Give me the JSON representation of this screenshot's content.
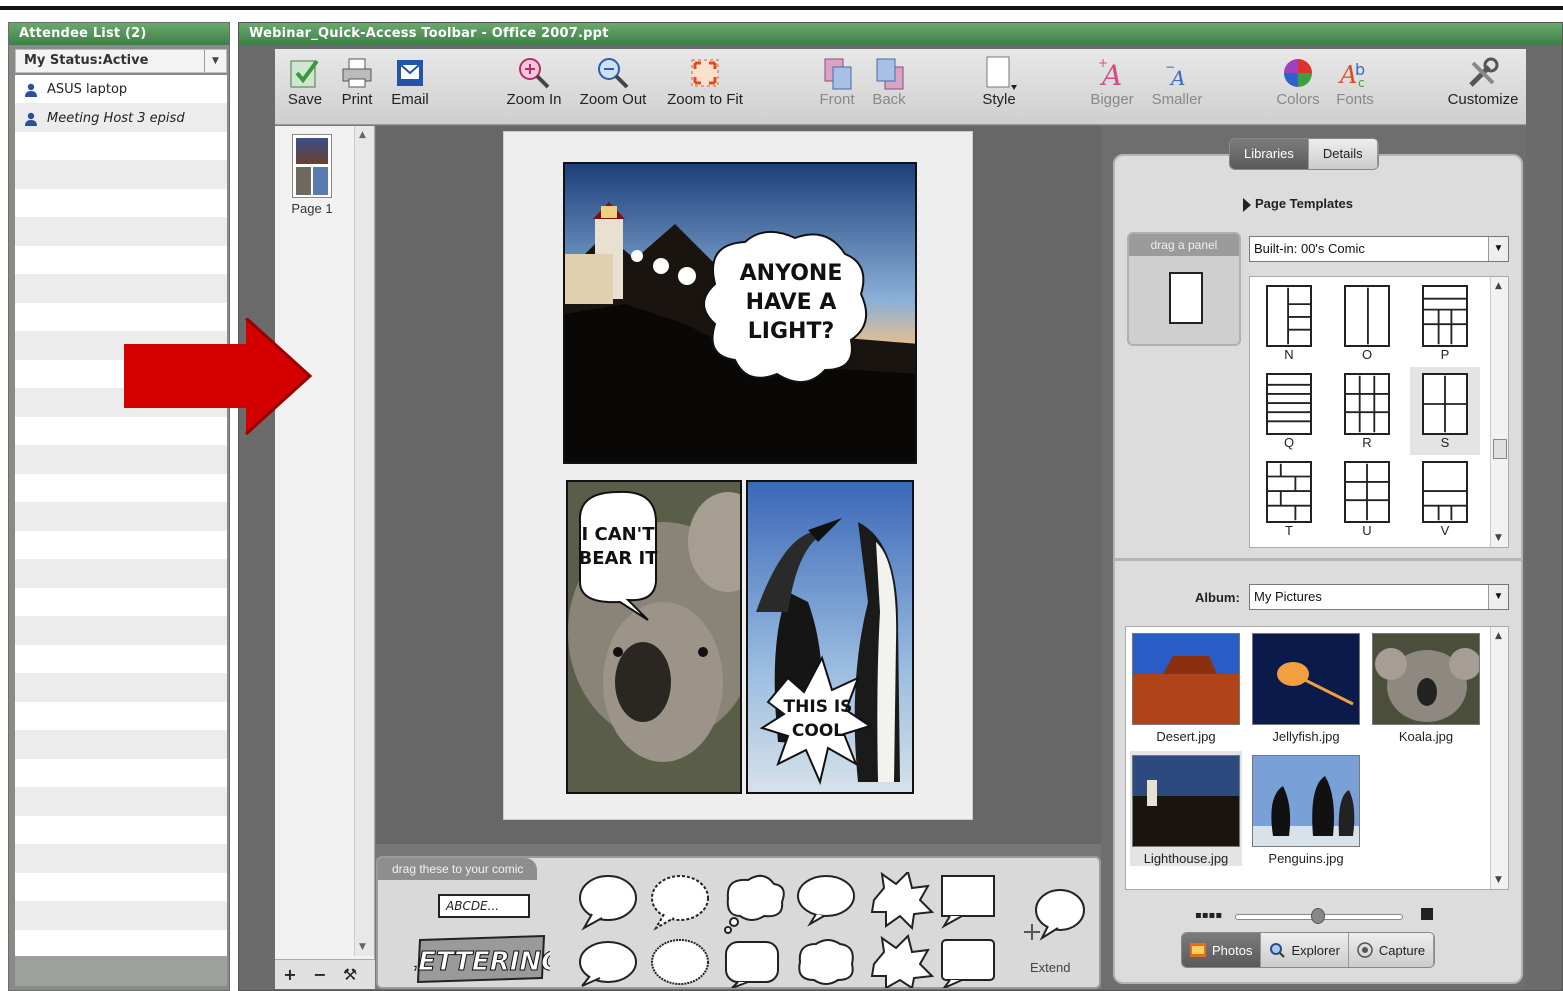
{
  "attendee_pod": {
    "title": "Attendee List (2)",
    "status": "My Status:Active",
    "attendees": [
      {
        "name": "ASUS laptop"
      },
      {
        "name": "Meeting Host 3 episd"
      }
    ]
  },
  "share_pod": {
    "title": "Webinar_Quick-Access Toolbar - Office 2007.ppt"
  },
  "toolbar": {
    "save": "Save",
    "print": "Print",
    "email": "Email",
    "zoom_in": "Zoom In",
    "zoom_out": "Zoom Out",
    "zoom_fit": "Zoom to Fit",
    "front": "Front",
    "back": "Back",
    "style": "Style",
    "bigger": "Bigger",
    "smaller": "Smaller",
    "colors": "Colors",
    "fonts": "Fonts",
    "customize": "Customize"
  },
  "page_strip": {
    "page_label": "Page 1",
    "add": "+",
    "remove": "−"
  },
  "comic": {
    "bubble1": [
      "ANYONE",
      "HAVE A",
      "LIGHT?"
    ],
    "bubble2": [
      "I CAN'T",
      "BEAR IT"
    ],
    "bubble3": [
      "THIS IS",
      "COOL"
    ]
  },
  "lettering": {
    "tab": "drag these to your comic",
    "text_box": "ABCDE...",
    "logo": "LETTERING",
    "extend": "Extend"
  },
  "right_panel": {
    "tabs": [
      "Libraries",
      "Details"
    ],
    "active_tab": "Libraries",
    "page_templates": "Page Templates",
    "drag_panel": "drag a panel",
    "template_select": "Built-in: 00's Comic",
    "templates": [
      "N",
      "O",
      "P",
      "Q",
      "R",
      "S",
      "T",
      "U",
      "V"
    ],
    "selected_template": "S",
    "album_label": "Album:",
    "album_select": "My Pictures",
    "photos": [
      "Desert.jpg",
      "Jellyfish.jpg",
      "Koala.jpg",
      "Lighthouse.jpg",
      "Penguins.jpg"
    ],
    "selected_photo": "Lighthouse.jpg",
    "bottom_tabs": [
      "Photos",
      "Explorer",
      "Capture"
    ],
    "active_bottom_tab": "Photos",
    "thumb_size": 0.55
  },
  "colors": {
    "pod_title_green": "#4c8f52",
    "arrow_red": "#d40000"
  }
}
